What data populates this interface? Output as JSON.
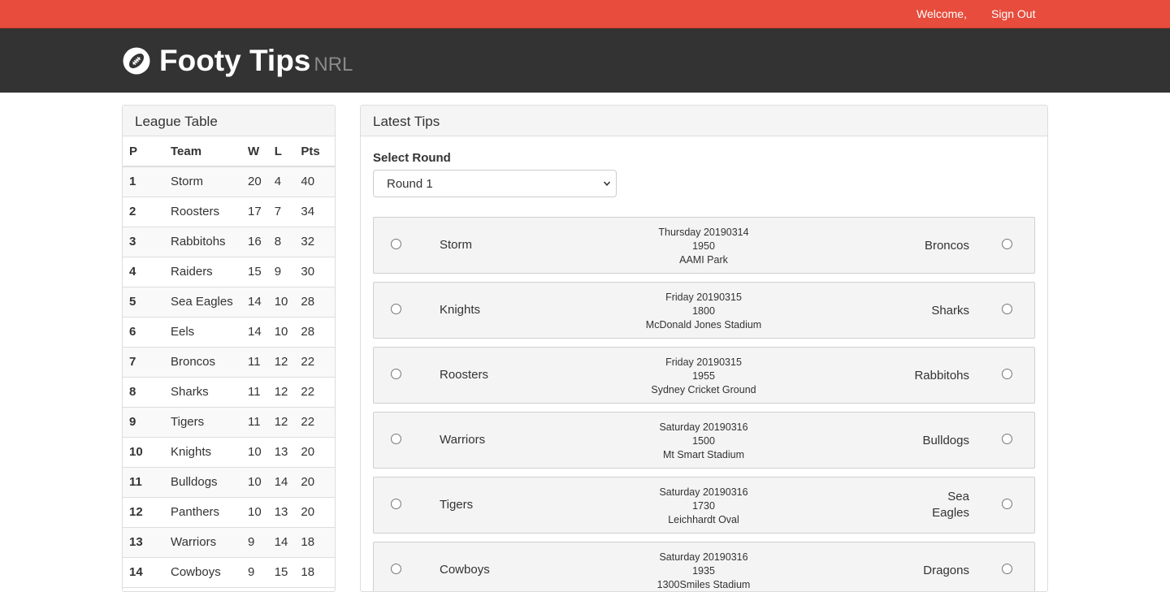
{
  "nav": {
    "welcome": "Welcome,",
    "sign_out": "Sign Out"
  },
  "brand": {
    "title": "Footy Tips",
    "subtitle": "NRL",
    "icon": "football-icon"
  },
  "league_table": {
    "heading": "League Table",
    "columns": [
      "P",
      "Team",
      "W",
      "L",
      "Pts"
    ],
    "rows": [
      {
        "p": "1",
        "team": "Storm",
        "w": "20",
        "l": "4",
        "pts": "40"
      },
      {
        "p": "2",
        "team": "Roosters",
        "w": "17",
        "l": "7",
        "pts": "34"
      },
      {
        "p": "3",
        "team": "Rabbitohs",
        "w": "16",
        "l": "8",
        "pts": "32"
      },
      {
        "p": "4",
        "team": "Raiders",
        "w": "15",
        "l": "9",
        "pts": "30"
      },
      {
        "p": "5",
        "team": "Sea Eagles",
        "w": "14",
        "l": "10",
        "pts": "28"
      },
      {
        "p": "6",
        "team": "Eels",
        "w": "14",
        "l": "10",
        "pts": "28"
      },
      {
        "p": "7",
        "team": "Broncos",
        "w": "11",
        "l": "12",
        "pts": "22"
      },
      {
        "p": "8",
        "team": "Sharks",
        "w": "11",
        "l": "12",
        "pts": "22"
      },
      {
        "p": "9",
        "team": "Tigers",
        "w": "11",
        "l": "12",
        "pts": "22"
      },
      {
        "p": "10",
        "team": "Knights",
        "w": "10",
        "l": "13",
        "pts": "20"
      },
      {
        "p": "11",
        "team": "Bulldogs",
        "w": "10",
        "l": "14",
        "pts": "20"
      },
      {
        "p": "12",
        "team": "Panthers",
        "w": "10",
        "l": "13",
        "pts": "20"
      },
      {
        "p": "13",
        "team": "Warriors",
        "w": "9",
        "l": "14",
        "pts": "18"
      },
      {
        "p": "14",
        "team": "Cowboys",
        "w": "9",
        "l": "15",
        "pts": "18"
      }
    ]
  },
  "tips": {
    "heading": "Latest Tips",
    "select_label": "Select Round",
    "selected_round": "Round 1",
    "matches": [
      {
        "home": "Storm",
        "away": "Broncos",
        "date": "Thursday 20190314",
        "time": "1950",
        "venue": "AAMI Park"
      },
      {
        "home": "Knights",
        "away": "Sharks",
        "date": "Friday 20190315",
        "time": "1800",
        "venue": "McDonald Jones Stadium"
      },
      {
        "home": "Roosters",
        "away": "Rabbitohs",
        "date": "Friday 20190315",
        "time": "1955",
        "venue": "Sydney Cricket Ground"
      },
      {
        "home": "Warriors",
        "away": "Bulldogs",
        "date": "Saturday 20190316",
        "time": "1500",
        "venue": "Mt Smart Stadium"
      },
      {
        "home": "Tigers",
        "away": "Sea Eagles",
        "date": "Saturday 20190316",
        "time": "1730",
        "venue": "Leichhardt Oval"
      },
      {
        "home": "Cowboys",
        "away": "Dragons",
        "date": "Saturday 20190316",
        "time": "1935",
        "venue": "1300Smiles Stadium"
      }
    ]
  },
  "colors": {
    "topbar": "#e74c3c",
    "header": "#333333",
    "panel_heading": "#f5f5f5",
    "match_bg": "#f4f4f4"
  }
}
